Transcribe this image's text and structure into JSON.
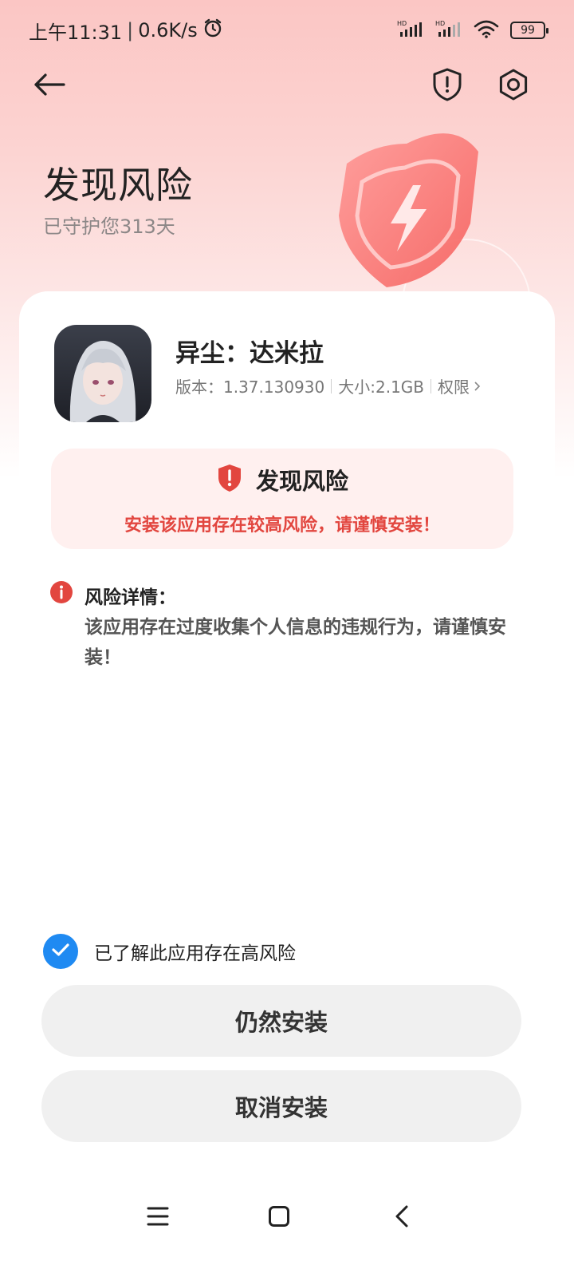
{
  "status_bar": {
    "time": "上午11:31",
    "net_speed": "0.6K/s",
    "signal_1_label": "HD",
    "signal_2_label": "HD",
    "battery": "99",
    "icons": [
      "alarm-icon",
      "signal-icon",
      "signal-icon",
      "wifi-icon",
      "battery-icon"
    ]
  },
  "nav": {
    "icons": [
      "back-arrow-icon",
      "shield-alert-icon",
      "settings-icon"
    ]
  },
  "hero": {
    "title": "发现风险",
    "subtitle": "已守护您313天"
  },
  "app": {
    "name": "异尘：达米拉",
    "version_label": "版本：1.37.130930",
    "size_label": "大小:2.1GB",
    "permissions_label": "权限"
  },
  "risk": {
    "title": "发现风险",
    "warning": "安装该应用存在较高风险，请谨慎安装！"
  },
  "details": {
    "label": "风险详情：",
    "body": "该应用存在过度收集个人信息的违规行为，请谨慎安装！"
  },
  "agreement": {
    "checked": true,
    "text": "已了解此应用存在高风险"
  },
  "buttons": {
    "install": "仍然安装",
    "cancel": "取消安装"
  },
  "colors": {
    "accent_blue": "#1f8af2",
    "risk_red": "#e2463f",
    "hero_pink": "#fbc6c4"
  }
}
